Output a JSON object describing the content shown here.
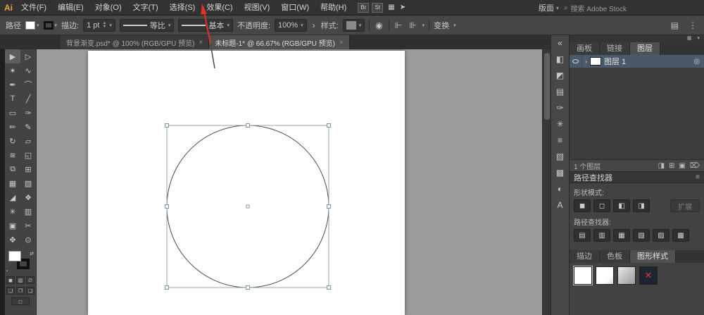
{
  "colors": {
    "annotation_arrow": "#e0312a",
    "annotation_tail": "#4a4a4a",
    "selection_outline": "#96a7b8"
  },
  "menubar": {
    "logo": "Ai",
    "items": [
      "文件(F)",
      "编辑(E)",
      "对象(O)",
      "文字(T)",
      "选择(S)",
      "效果(C)",
      "视图(V)",
      "窗口(W)",
      "帮助(H)"
    ],
    "bridge": "Br",
    "stock": "St",
    "grid_icon": "▦",
    "share_icon": "➤",
    "workspace_label": "版面",
    "workspace_chevron": "▾",
    "search_icon": "⌕",
    "search_text": "搜索 Adobe Stock"
  },
  "optionsbar": {
    "selection_label": "路径",
    "fill_arrow": "▾",
    "stroke_arrow": "▾",
    "stroke_label": "描边:",
    "stroke_weight": "1 pt",
    "step_up": "▲",
    "step_down": "▼",
    "weight_arrow": "▾",
    "profile_value": "等比",
    "profile_arrow": "▾",
    "brush_value": "基本",
    "brush_arrow": "▾",
    "opacity_label": "不透明度:",
    "opacity_value": "100%",
    "opacity_arrow": "▾",
    "opacity_more": "›",
    "style_label": "样式:",
    "style_arrow": "▾",
    "recolor_icon": "◉",
    "align_icon_1": "⊩",
    "align_icon_2": "⊪",
    "align_arrow": "▾",
    "transform_label": "变换",
    "transform_arrow": "▾",
    "extra_icon_1": "▤",
    "extra_icon_2": "⋮"
  },
  "doc_tabs": [
    {
      "title": "背景渐变.psd* @ 100% (RGB/GPU 预览)",
      "close": "×"
    },
    {
      "title": "未标题-1* @ 66.67% (RGB/GPU 预览)",
      "close": "×"
    }
  ],
  "tools": [
    {
      "name": "selection",
      "glyph": "▶"
    },
    {
      "name": "direct-selection",
      "glyph": "▷"
    },
    {
      "name": "magic-wand",
      "glyph": "✶"
    },
    {
      "name": "lasso",
      "glyph": "∿"
    },
    {
      "name": "pen",
      "glyph": "✒"
    },
    {
      "name": "curvature",
      "glyph": "⌒"
    },
    {
      "name": "type",
      "glyph": "T"
    },
    {
      "name": "line-segment",
      "glyph": "╱"
    },
    {
      "name": "rectangle",
      "glyph": "▭"
    },
    {
      "name": "paintbrush",
      "glyph": "✑"
    },
    {
      "name": "shaper",
      "glyph": "✏"
    },
    {
      "name": "pencil",
      "glyph": "✎"
    },
    {
      "name": "rotate",
      "glyph": "↻"
    },
    {
      "name": "scale",
      "glyph": "▱"
    },
    {
      "name": "width",
      "glyph": "≋"
    },
    {
      "name": "free-transform",
      "glyph": "◱"
    },
    {
      "name": "shape-builder",
      "glyph": "⧉"
    },
    {
      "name": "perspective-grid",
      "glyph": "⊞"
    },
    {
      "name": "mesh",
      "glyph": "▦"
    },
    {
      "name": "gradient",
      "glyph": "▧"
    },
    {
      "name": "eyedropper",
      "glyph": "◢"
    },
    {
      "name": "blend",
      "glyph": "❖"
    },
    {
      "name": "symbol-sprayer",
      "glyph": "✳"
    },
    {
      "name": "column-graph",
      "glyph": "▥"
    },
    {
      "name": "artboard",
      "glyph": "▣"
    },
    {
      "name": "slice",
      "glyph": "✂"
    },
    {
      "name": "hand",
      "glyph": "✥"
    },
    {
      "name": "zoom",
      "glyph": "⊙"
    }
  ],
  "toolbar_bottom": {
    "swap": "⇄",
    "default": "▪",
    "color": "◼",
    "gradient": "▨",
    "none": "∅",
    "draw_normal": "❏",
    "draw_behind": "❐",
    "draw_inside": "❑",
    "screen_mode": "◻"
  },
  "dock_icons": [
    {
      "name": "collapse-dock",
      "glyph": "«"
    },
    {
      "name": "color-panel",
      "glyph": "◧"
    },
    {
      "name": "color-guide-panel",
      "glyph": "◩"
    },
    {
      "name": "swatches-panel",
      "glyph": "▤"
    },
    {
      "name": "brushes-panel",
      "glyph": "✑"
    },
    {
      "name": "symbols-panel",
      "glyph": "✳"
    },
    {
      "name": "stroke-panel",
      "glyph": "≡"
    },
    {
      "name": "gradient-panel",
      "glyph": "▧"
    },
    {
      "name": "transparency-panel",
      "glyph": "▩"
    },
    {
      "name": "appearance-panel",
      "glyph": "◐"
    },
    {
      "name": "character-panel",
      "glyph": "A"
    }
  ],
  "right": {
    "top_icons": {
      "dock": "▦",
      "chevron": "▾"
    },
    "panel_tabs": [
      "画板",
      "链接",
      "图层"
    ],
    "layers": {
      "chevron": "›",
      "name": "图层 1",
      "target": "◎",
      "count_text": "1 个图层",
      "footer_icons": [
        "◨",
        "⊞",
        "▣",
        "⌦"
      ]
    },
    "pathfinder": {
      "title": "路径查找器",
      "menu_icon": "≡",
      "shape_modes_label": "形状模式:",
      "shape_buttons": [
        "◼",
        "◻",
        "◧",
        "◨"
      ],
      "expand_button": "扩展",
      "pathfinders_label": "路径查找器:",
      "pf_buttons": [
        "▤",
        "▥",
        "▦",
        "▧",
        "▨",
        "▩"
      ]
    },
    "style_tabs": [
      "描边",
      "色板",
      "图形样式"
    ],
    "style_thumb_4_glyph": "✕"
  }
}
